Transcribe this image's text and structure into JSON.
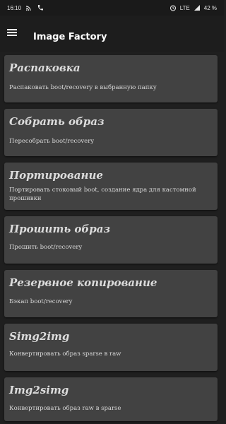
{
  "status_bar": {
    "time": "16:10",
    "network": "LTE",
    "battery": "42 %"
  },
  "app_bar": {
    "title": "Image Factory"
  },
  "cards": [
    {
      "title": "Распаковка",
      "description": "Распаковать boot/recovery в выбранную папку"
    },
    {
      "title": "Собрать образ",
      "description": "Пересобрать boot/recovery"
    },
    {
      "title": "Портирование",
      "description": "Портировать стоковый boot, создание ядра для кастомной прошивки"
    },
    {
      "title": "Прошить образ",
      "description": "Прошить boot/recovery"
    },
    {
      "title": "Резервное копирование",
      "description": "Бэкап boot/recovery"
    },
    {
      "title": "Simg2img",
      "description": "Конвертировать образ sparse в raw"
    },
    {
      "title": "Img2simg",
      "description": "Конвертировать образ raw в sparse"
    }
  ]
}
